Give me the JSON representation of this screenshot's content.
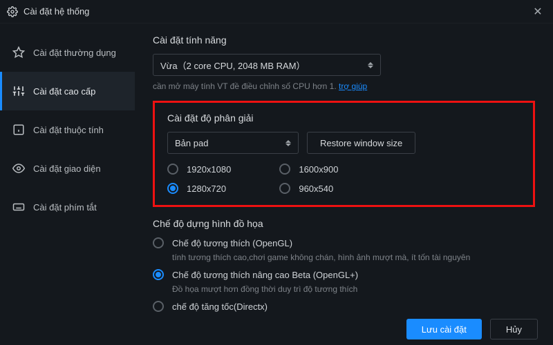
{
  "titlebar": {
    "title": "Cài đặt hệ thống"
  },
  "sidebar": {
    "items": [
      {
        "label": "Cài đặt thường dụng"
      },
      {
        "label": "Cài đặt cao cấp"
      },
      {
        "label": "Cài đặt thuộc tính"
      },
      {
        "label": "Cài đặt giao diện"
      },
      {
        "label": "Cài đặt phím tắt"
      }
    ]
  },
  "feature": {
    "title": "Cài đặt tính năng",
    "dropdown": "Vừa（2 core CPU, 2048 MB RAM）",
    "hint_prefix": "cần mở máy tính VT đề điều chỉnh số CPU hơn 1. ",
    "hint_link": "trợ giúp"
  },
  "resolution": {
    "title": "Cài đặt độ phân giải",
    "dropdown": "Bản pad",
    "restore_btn": "Restore window size",
    "options": {
      "col1": [
        "1920x1080",
        "1280x720"
      ],
      "col2": [
        "1600x900",
        "960x540"
      ]
    },
    "selected": "1280x720"
  },
  "graphics": {
    "title": "Chế độ dựng hình đồ họa",
    "options": [
      {
        "label": "Chế độ tương thích (OpenGL)",
        "desc": "tính tương thích cao,chơi game không chán, hình ảnh mượt mà, ít tốn tài nguyên",
        "selected": false
      },
      {
        "label": "Chế độ tương thích nâng cao Beta (OpenGL+)",
        "desc": "Đồ họa mượt hơn đồng thời duy trì độ tương thích",
        "selected": true
      },
      {
        "label": "chế độ tăng tốc(Directx)",
        "desc": "",
        "selected": false
      }
    ]
  },
  "footer": {
    "save": "Lưu cài đặt",
    "cancel": "Hủy"
  }
}
